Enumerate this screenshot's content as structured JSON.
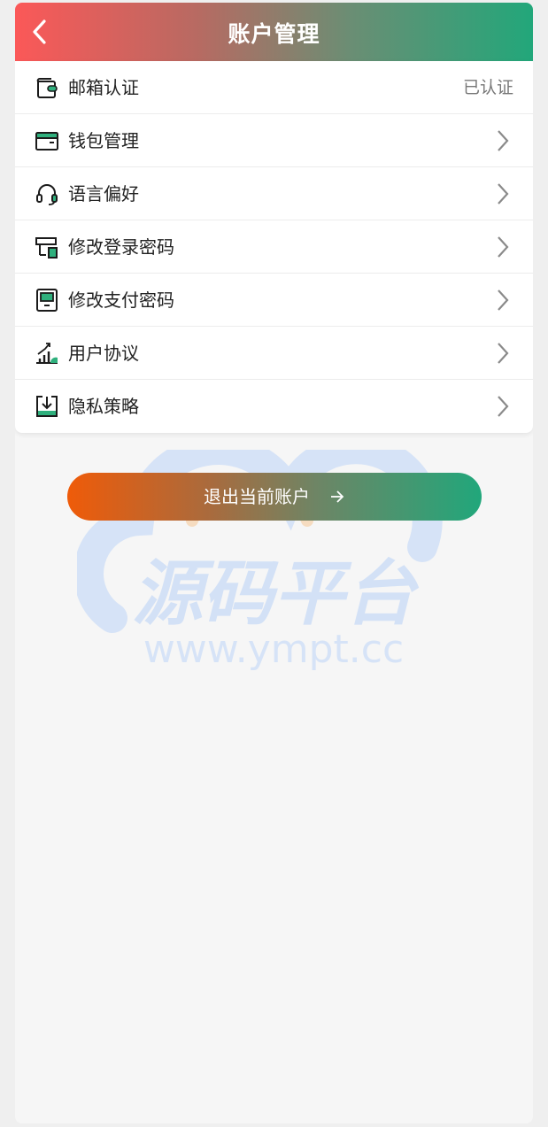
{
  "header": {
    "title": "账户管理"
  },
  "menu": {
    "items": [
      {
        "label": "邮箱认证",
        "value": "已认证",
        "icon": "wallet-icon"
      },
      {
        "label": "钱包管理",
        "icon": "card-icon"
      },
      {
        "label": "语言偏好",
        "icon": "headset-icon"
      },
      {
        "label": "修改登录密码",
        "icon": "monitor-lock-icon"
      },
      {
        "label": "修改支付密码",
        "icon": "device-icon"
      },
      {
        "label": "用户协议",
        "icon": "chart-growth-icon"
      },
      {
        "label": "隐私策略",
        "icon": "download-tray-icon"
      }
    ]
  },
  "logout": {
    "label": "退出当前账户"
  },
  "watermark": {
    "brand": "源码平台",
    "url": "www.ympt.cc"
  },
  "colors": {
    "accent_green": "#22a77a",
    "accent_red": "#fb5858",
    "accent_orange": "#ef5b09"
  }
}
